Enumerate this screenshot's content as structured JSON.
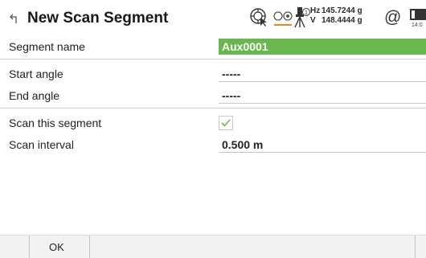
{
  "header": {
    "title": "New Scan Segment",
    "back_icon": "return-arrow-icon",
    "status_icons": [
      "target-icon",
      "prism-icon",
      "tripod-station-icon",
      "at-icon",
      "battery-icon"
    ],
    "station_number": "1",
    "hz_label": "Hz",
    "hz_value": "145.7244 g",
    "v_label": "V",
    "v_value": "148.4444 g",
    "at_symbol": "@",
    "time": "14:0"
  },
  "form": {
    "segment_name": {
      "label": "Segment name",
      "value": "Aux0001"
    },
    "start_angle": {
      "label": "Start angle",
      "value": "-----"
    },
    "end_angle": {
      "label": "End angle",
      "value": "-----"
    },
    "scan_this_segment": {
      "label": "Scan this segment",
      "checked": true
    },
    "scan_interval": {
      "label": "Scan interval",
      "value": "0.500 m"
    }
  },
  "footer": {
    "ok_label": "OK"
  },
  "colors": {
    "accent": "#6ab84d",
    "prism_accent": "#e08a2c",
    "check": "#6ab84d"
  }
}
